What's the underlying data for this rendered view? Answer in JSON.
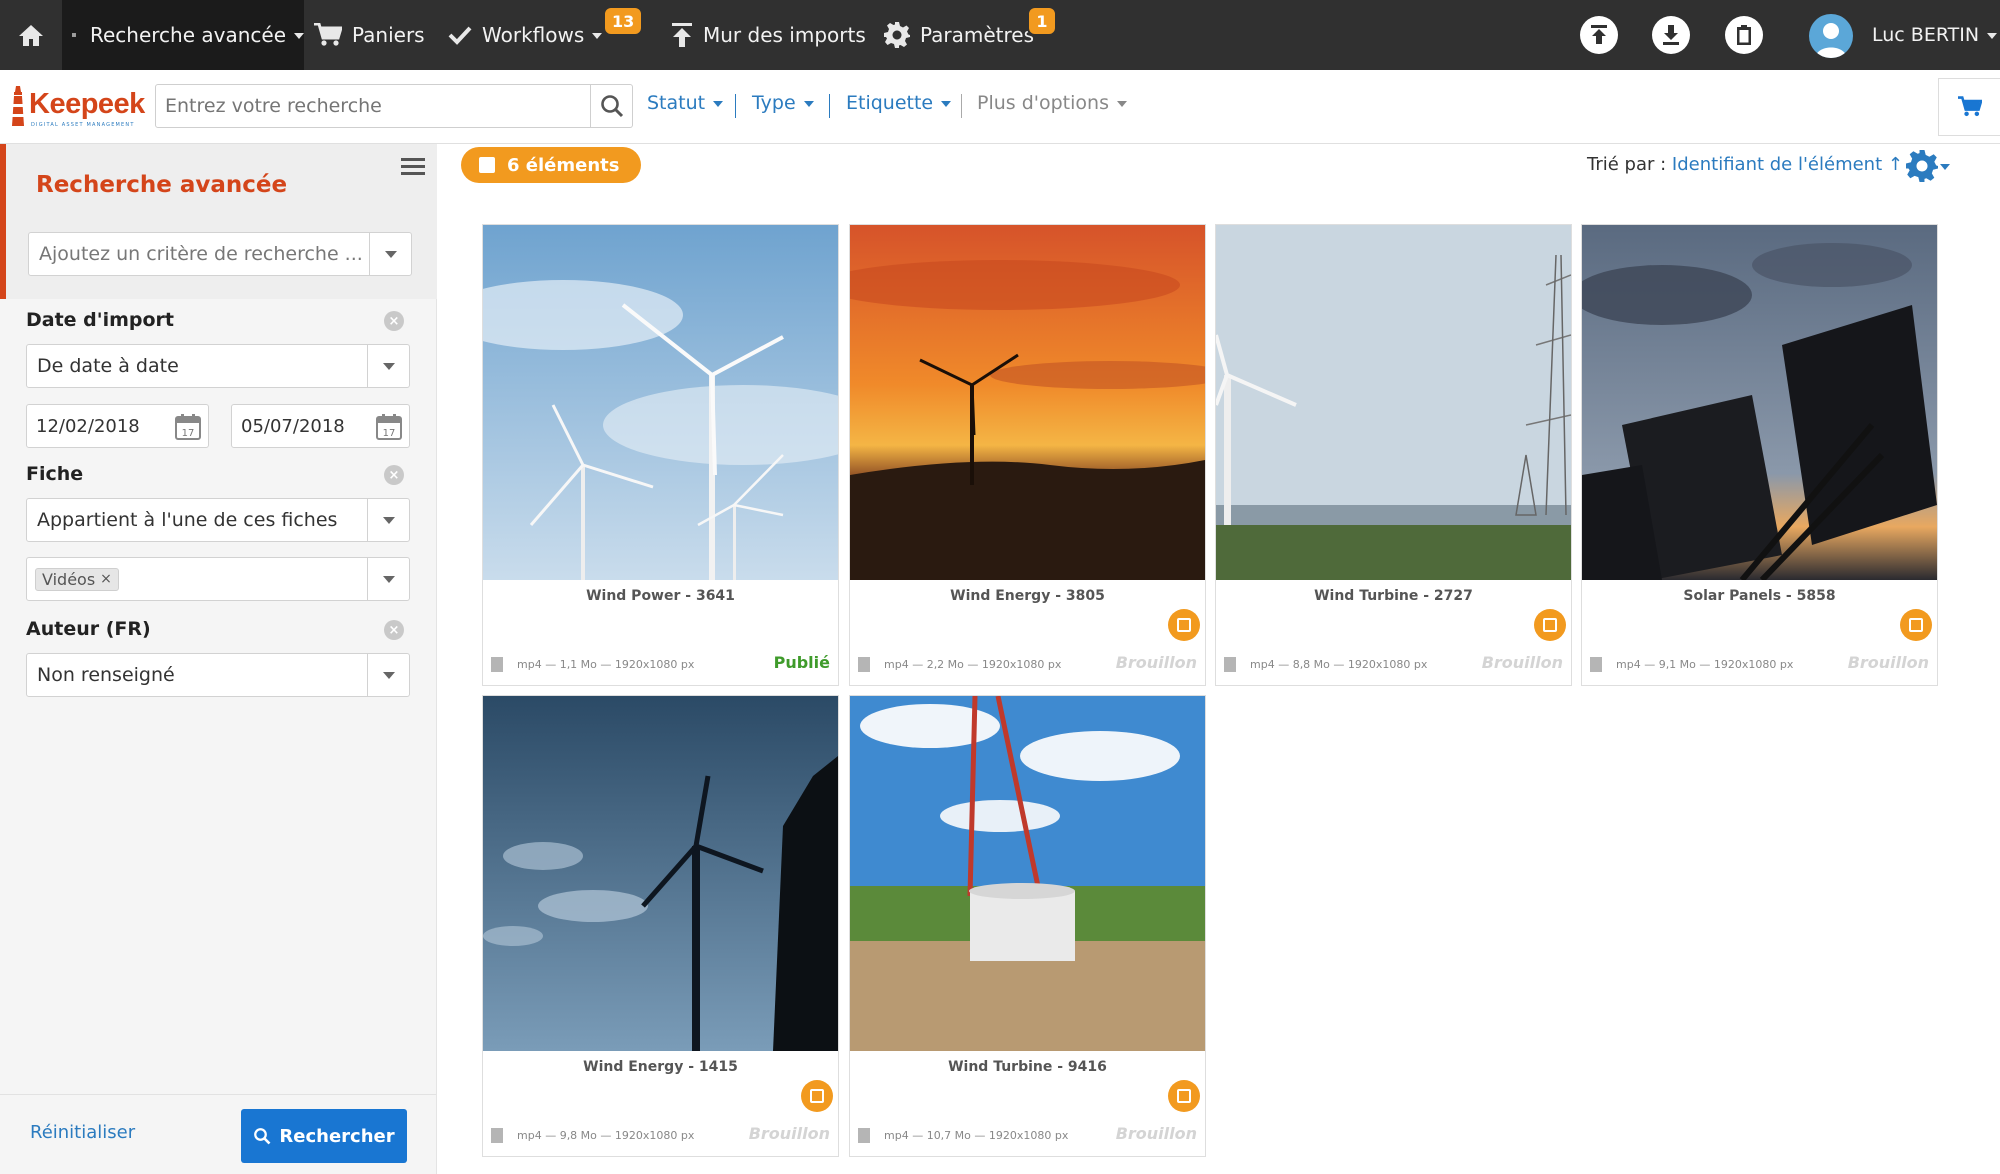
{
  "topbar": {
    "recherche_label": "Recherche avancée",
    "paniers_label": "Paniers",
    "workflows_label": "Workflows",
    "workflows_badge": "13",
    "mur_label": "Mur des imports",
    "parametres_label": "Paramètres",
    "parametres_badge": "1",
    "user_name": "Luc BERTIN"
  },
  "logo": {
    "name": "Keepeek",
    "tagline": "DIGITAL ASSET MANAGEMENT"
  },
  "search": {
    "placeholder": "Entrez votre recherche",
    "filters": [
      {
        "label": "Statut"
      },
      {
        "label": "Type"
      },
      {
        "label": "Etiquette"
      },
      {
        "label": "Plus d'options"
      }
    ]
  },
  "sidebar": {
    "title": "Recherche avancée",
    "criteria_placeholder": "Ajoutez un critère de recherche ...",
    "sections": {
      "date": {
        "label": "Date d'import",
        "mode": "De date à date",
        "from": "12/02/2018",
        "to": "05/07/2018",
        "cal_day": "17"
      },
      "fiche": {
        "label": "Fiche",
        "mode": "Appartient à l'une de ces fiches",
        "tag": "Vidéos"
      },
      "auteur": {
        "label": "Auteur (FR)",
        "value": "Non renseigné"
      }
    },
    "reset_label": "Réinitialiser",
    "search_label": "Rechercher"
  },
  "results": {
    "count_label": "6 éléments",
    "sort_prefix": "Trié par : ",
    "sort_value": "Identifiant de l'élément ↑",
    "items": [
      {
        "title": "Wind Power - 3641",
        "meta": "mp4 — 1,1 Mo — 1920x1080 px",
        "status": "Publié"
      },
      {
        "title": "Wind Energy - 3805",
        "meta": "mp4 — 2,2 Mo — 1920x1080 px",
        "status": "Brouillon"
      },
      {
        "title": "Wind Turbine - 2727",
        "meta": "mp4 — 8,8 Mo — 1920x1080 px",
        "status": "Brouillon"
      },
      {
        "title": "Solar Panels - 5858",
        "meta": "mp4 — 9,1 Mo — 1920x1080 px",
        "status": "Brouillon"
      },
      {
        "title": "Wind Energy - 1415",
        "meta": "mp4 — 9,8 Mo — 1920x1080 px",
        "status": "Brouillon"
      },
      {
        "title": "Wind Turbine - 9416",
        "meta": "mp4 — 10,7 Mo — 1920x1080 px",
        "status": "Brouillon"
      }
    ]
  },
  "colors": {
    "accent_orange": "#f29a1f",
    "brand_red": "#d4451a",
    "link_blue": "#2b7bbf",
    "primary_blue": "#1976d2",
    "published_green": "#3f9b2b"
  }
}
